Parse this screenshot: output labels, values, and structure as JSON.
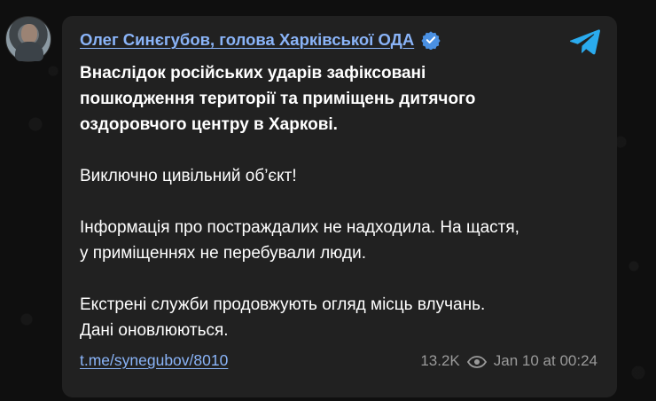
{
  "post": {
    "author": "Олег Синєгубов, голова Харківської ОДА",
    "verified_icon": "verified-badge-icon",
    "platform_icon": "telegram-icon",
    "paragraphs": [
      "Внаслідок російських ударів зафіксовані\nпошкодження території та приміщень дитячого\nоздоровчого центру в Харкові.",
      "Виключно цивільний об’єкт!",
      "Інформація про постраждалих не надходила. На щастя,\nу приміщеннях не перебували люди.",
      "Екстрені служби продовжують огляд місць влучань.\nДані оновлюються."
    ],
    "link": "t.me/synegubov/8010",
    "views": "13.2K",
    "date": "Jan 10 at 00:24"
  },
  "colors": {
    "background": "#0f0f0f",
    "card": "#212121",
    "link": "#8ab4f8",
    "text": "#ffffff",
    "meta": "#9a9a9a",
    "verified": "#4a90e2",
    "telegram": "#2aabee"
  }
}
